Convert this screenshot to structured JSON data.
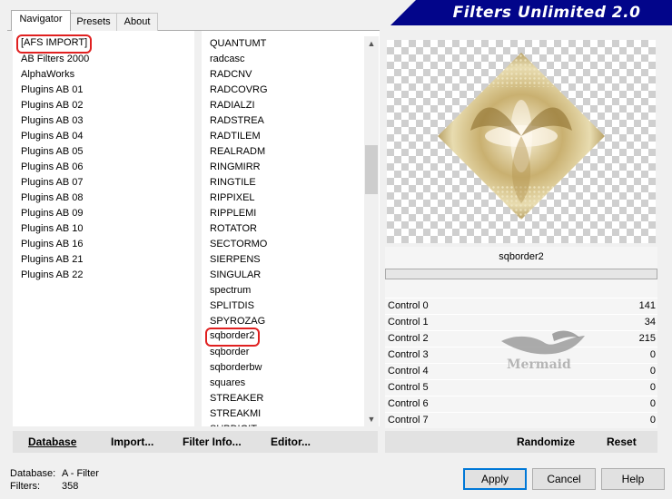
{
  "tabs": [
    "Navigator",
    "Presets",
    "About"
  ],
  "banner_title": "Filters Unlimited 2.0",
  "categories": [
    "[AFS IMPORT]",
    "AB Filters 2000",
    "AlphaWorks",
    "Plugins AB 01",
    "Plugins AB 02",
    "Plugins AB 03",
    "Plugins AB 04",
    "Plugins AB 05",
    "Plugins AB 06",
    "Plugins AB 07",
    "Plugins AB 08",
    "Plugins AB 09",
    "Plugins AB 10",
    "Plugins AB 16",
    "Plugins AB 21",
    "Plugins AB 22"
  ],
  "filters": [
    "QUANTUMT",
    "radcasc",
    "RADCNV",
    "RADCOVRG",
    "RADIALZI",
    "RADSTREA",
    "RADTILEM",
    "REALRADM",
    "RINGMIRR",
    "RINGTILE",
    "RIPPIXEL",
    "RIPPLEMI",
    "ROTATOR",
    "SECTORMO",
    "SIERPENS",
    "SINGULAR",
    "spectrum",
    "SPLITDIS",
    "SPYROZAG",
    "sqborder2",
    "sqborder",
    "sqborderbw",
    "squares",
    "STREAKER",
    "STREAKMI",
    "SUBDIGIT"
  ],
  "selected_filter_name": "sqborder2",
  "controls": [
    {
      "label": "Control 0",
      "value": "141"
    },
    {
      "label": "Control 1",
      "value": "34"
    },
    {
      "label": "Control 2",
      "value": "215"
    },
    {
      "label": "Control 3",
      "value": "0"
    },
    {
      "label": "Control 4",
      "value": "0"
    },
    {
      "label": "Control 5",
      "value": "0"
    },
    {
      "label": "Control 6",
      "value": "0"
    },
    {
      "label": "Control 7",
      "value": "0"
    }
  ],
  "watermark": "Mermaid",
  "buttons": {
    "database": "Database",
    "import": "Import...",
    "filter_info": "Filter Info...",
    "editor": "Editor...",
    "randomize": "Randomize",
    "reset": "Reset",
    "apply": "Apply",
    "cancel": "Cancel",
    "help": "Help"
  },
  "status": {
    "database_label": "Database:",
    "database_value": "A - Filter",
    "filters_label": "Filters:",
    "filters_value": "358"
  },
  "colors": {
    "banner": "#02058a",
    "highlight": "#e02020",
    "default_button": "#0078d7"
  }
}
